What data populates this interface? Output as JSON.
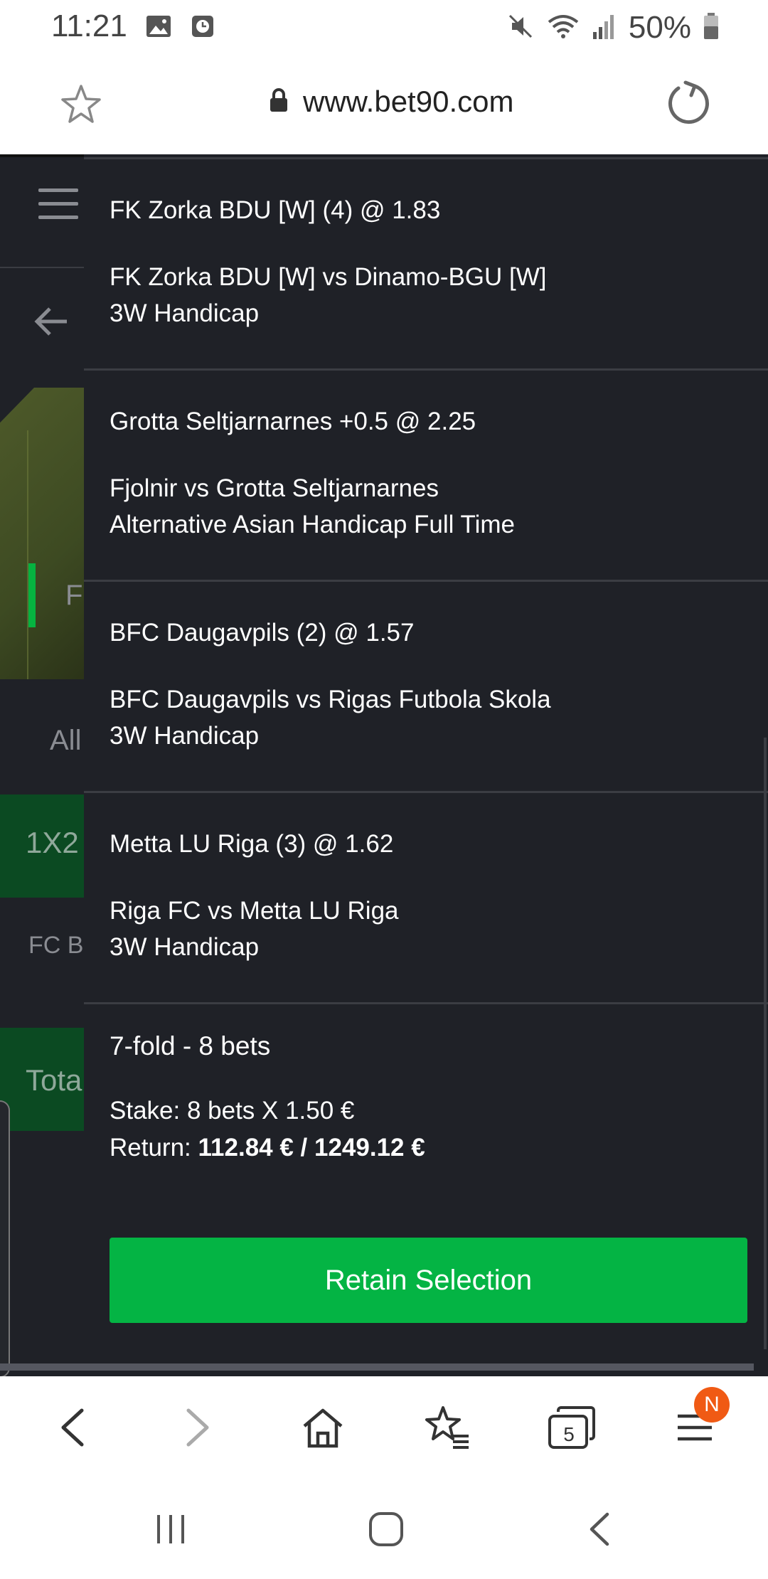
{
  "status_bar": {
    "time": "11:21",
    "battery": "50%"
  },
  "browser": {
    "url": "www.bet90.com",
    "tabs_count": "5",
    "notification_badge": "N"
  },
  "background": {
    "labels": {
      "fc_partial": "F(",
      "all_partial": "All",
      "one_x_two": "1X2",
      "fcb_partial": "FC B",
      "total_partial": "Tota"
    }
  },
  "selections": [
    {
      "title": "FK Zorka BDU [W] (4)  @ 1.83",
      "match": "FK Zorka BDU [W] vs Dinamo-BGU [W]",
      "market": "3W Handicap"
    },
    {
      "title": "Grotta Seltjarnarnes  +0.5  @ 2.25",
      "match": "Fjolnir vs Grotta Seltjarnarnes",
      "market": "Alternative Asian Handicap Full Time"
    },
    {
      "title": "BFC Daugavpils (2)  @ 1.57",
      "match": "BFC Daugavpils vs Rigas Futbola Skola",
      "market": "3W Handicap"
    },
    {
      "title": "Metta LU Riga (3)  @ 1.62",
      "match": "Riga FC vs Metta LU Riga",
      "market": "3W Handicap"
    }
  ],
  "summary": {
    "fold": "7-fold - 8 bets",
    "stake": "Stake:  8 bets X 1.50 €",
    "return_label": "Return: ",
    "return_value": "112.84 € / 1249.12 €"
  },
  "retain_button": "Retain Selection",
  "colors": {
    "panel_bg": "#1f2127",
    "accent_green": "#04b444",
    "badge_orange": "#f05a14"
  },
  "icons": {
    "status_left": [
      "gallery-icon",
      "clock-icon"
    ],
    "status_right": [
      "mute-icon",
      "wifi-icon",
      "signal-icon",
      "battery-icon"
    ],
    "toolbar": [
      "back-icon",
      "forward-icon",
      "home-icon",
      "bookmarks-icon",
      "tabs-icon",
      "menu-icon"
    ],
    "nav": [
      "recent-apps-icon",
      "home-nav-icon",
      "back-nav-icon"
    ]
  }
}
